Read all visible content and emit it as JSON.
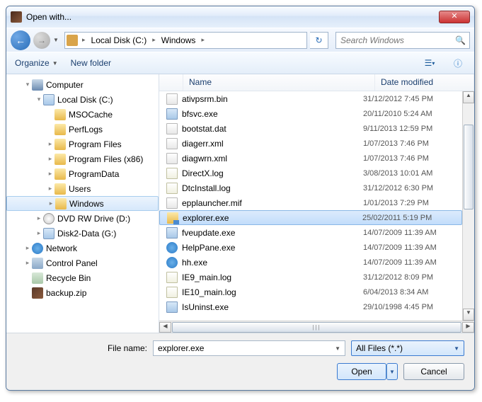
{
  "window_title": "Open with...",
  "breadcrumb": {
    "root_icon": "computer",
    "seg1": "Local Disk (C:)",
    "seg2": "Windows"
  },
  "search_placeholder": "Search Windows",
  "toolbar": {
    "organize": "Organize",
    "newfolder": "New folder"
  },
  "tree": [
    {
      "depth": 1,
      "exp": "▾",
      "icon": "comp-icon",
      "label": "Computer"
    },
    {
      "depth": 2,
      "exp": "▾",
      "icon": "drive-icon",
      "label": "Local Disk (C:)"
    },
    {
      "depth": 3,
      "exp": "",
      "icon": "folder-icon",
      "label": "MSOCache"
    },
    {
      "depth": 3,
      "exp": "",
      "icon": "folder-icon",
      "label": "PerfLogs"
    },
    {
      "depth": 3,
      "exp": "▸",
      "icon": "folder-icon",
      "label": "Program Files"
    },
    {
      "depth": 3,
      "exp": "▸",
      "icon": "folder-icon",
      "label": "Program Files (x86)"
    },
    {
      "depth": 3,
      "exp": "▸",
      "icon": "folder-icon",
      "label": "ProgramData"
    },
    {
      "depth": 3,
      "exp": "▸",
      "icon": "folder-icon",
      "label": "Users"
    },
    {
      "depth": 3,
      "exp": "▸",
      "icon": "folder-icon",
      "label": "Windows",
      "sel": true
    },
    {
      "depth": 2,
      "exp": "▸",
      "icon": "dvd-icon",
      "label": "DVD RW Drive (D:)"
    },
    {
      "depth": 2,
      "exp": "▸",
      "icon": "drive-icon",
      "label": "Disk2-Data (G:)"
    },
    {
      "depth": 1,
      "exp": "▸",
      "icon": "net-icon",
      "label": "Network"
    },
    {
      "depth": 1,
      "exp": "▸",
      "icon": "cp-icon",
      "label": "Control Panel"
    },
    {
      "depth": 1,
      "exp": "",
      "icon": "bin-icon",
      "label": "Recycle Bin"
    },
    {
      "depth": 1,
      "exp": "",
      "icon": "zip-icon",
      "label": "backup.zip"
    }
  ],
  "columns": {
    "name": "Name",
    "date": "Date modified"
  },
  "files": [
    {
      "icon": "file-icon",
      "name": "ativpsrm.bin",
      "date": "31/12/2012 7:45 PM"
    },
    {
      "icon": "exe-icon",
      "name": "bfsvc.exe",
      "date": "20/11/2010 5:24 AM"
    },
    {
      "icon": "file-icon",
      "name": "bootstat.dat",
      "date": "9/11/2013 12:59 PM"
    },
    {
      "icon": "file-icon",
      "name": "diagerr.xml",
      "date": "1/07/2013 7:46 PM"
    },
    {
      "icon": "file-icon",
      "name": "diagwrn.xml",
      "date": "1/07/2013 7:46 PM"
    },
    {
      "icon": "log-icon",
      "name": "DirectX.log",
      "date": "3/08/2013 10:01 AM"
    },
    {
      "icon": "log-icon",
      "name": "DtcInstall.log",
      "date": "31/12/2012 6:30 PM"
    },
    {
      "icon": "file-icon",
      "name": "epplauncher.mif",
      "date": "1/01/2013 7:29 PM"
    },
    {
      "icon": "explorer-icon",
      "name": "explorer.exe",
      "date": "25/02/2011 5:19 PM",
      "sel": true
    },
    {
      "icon": "exe-icon",
      "name": "fveupdate.exe",
      "date": "14/07/2009 11:39 AM"
    },
    {
      "icon": "help-icon",
      "name": "HelpPane.exe",
      "date": "14/07/2009 11:39 AM"
    },
    {
      "icon": "help-icon",
      "name": "hh.exe",
      "date": "14/07/2009 11:39 AM"
    },
    {
      "icon": "log-icon",
      "name": "IE9_main.log",
      "date": "31/12/2012 8:09 PM"
    },
    {
      "icon": "log-icon",
      "name": "IE10_main.log",
      "date": "6/04/2013 8:34 AM"
    },
    {
      "icon": "exe-icon",
      "name": "IsUninst.exe",
      "date": "29/10/1998 4:45 PM"
    }
  ],
  "filename_label": "File name:",
  "filename_value": "explorer.exe",
  "filter_value": "All Files (*.*)",
  "buttons": {
    "open": "Open",
    "cancel": "Cancel"
  }
}
